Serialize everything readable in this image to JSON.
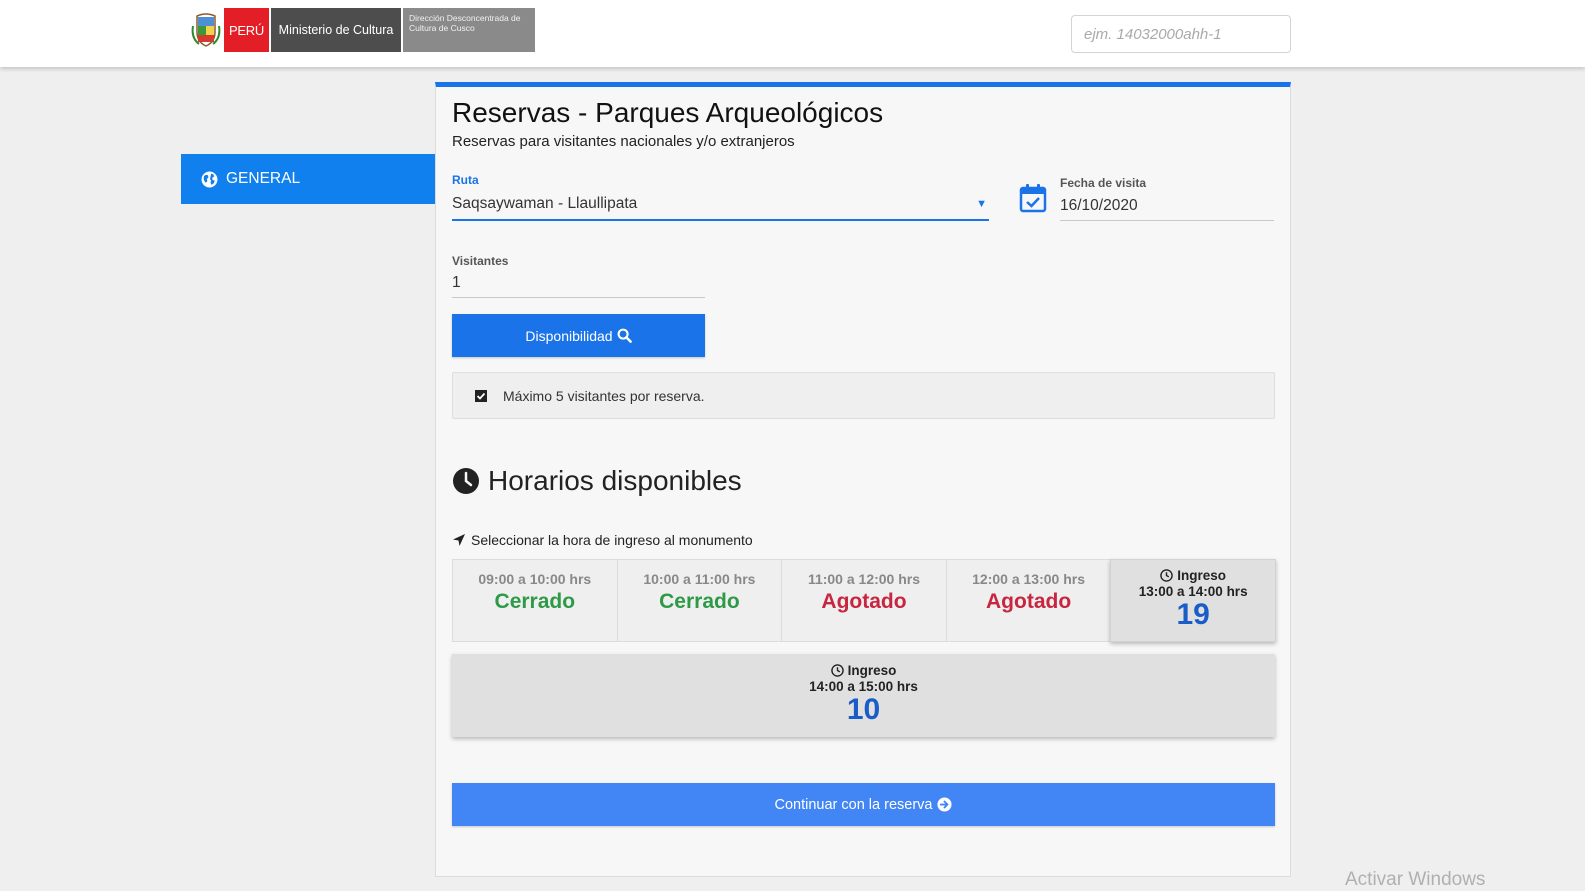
{
  "header": {
    "logo_peru": "PERÚ",
    "logo_ministerio": "Ministerio de Cultura",
    "logo_direccion": "Dirección Desconcentrada de Cultura de Cusco",
    "search_placeholder": "ejm. 14032000ahh-1"
  },
  "sidebar": {
    "items": [
      {
        "label": "GENERAL",
        "icon": "globe-icon",
        "active": true
      }
    ]
  },
  "form": {
    "title": "Reservas - Parques Arqueológicos",
    "subtitle": "Reservas para visitantes nacionales y/o extranjeros",
    "ruta_label": "Ruta",
    "ruta_value": "Saqsaywaman - Llaullipata",
    "fecha_label": "Fecha de visita",
    "fecha_value": "16/10/2020",
    "visitantes_label": "Visitantes",
    "visitantes_value": "1",
    "disponibilidad_button": "Disponibilidad",
    "notice": "Máximo 5 visitantes por reserva."
  },
  "horarios": {
    "title": "Horarios disponibles",
    "hint": "Seleccionar la hora de ingreso al monumento",
    "ingreso_label": "Ingreso",
    "slots": [
      {
        "time": "09:00 a 10:00 hrs",
        "status": "Cerrado"
      },
      {
        "time": "10:00 a 11:00 hrs",
        "status": "Cerrado"
      },
      {
        "time": "11:00 a 12:00 hrs",
        "status": "Agotado"
      },
      {
        "time": "12:00 a 13:00 hrs",
        "status": "Agotado"
      },
      {
        "time": "13:00 a 14:00 hrs",
        "available": "19"
      },
      {
        "time": "14:00 a 15:00 hrs",
        "available": "10"
      }
    ]
  },
  "continue_button": "Continuar con la reserva",
  "watermark": "Activar Windows",
  "colors": {
    "primary": "#1a73e8",
    "sidebar_active": "#0f80ee",
    "continue": "#4285f4",
    "cerrado": "#2e9a47",
    "agotado": "#c8253f",
    "count": "#1a5dc9"
  }
}
